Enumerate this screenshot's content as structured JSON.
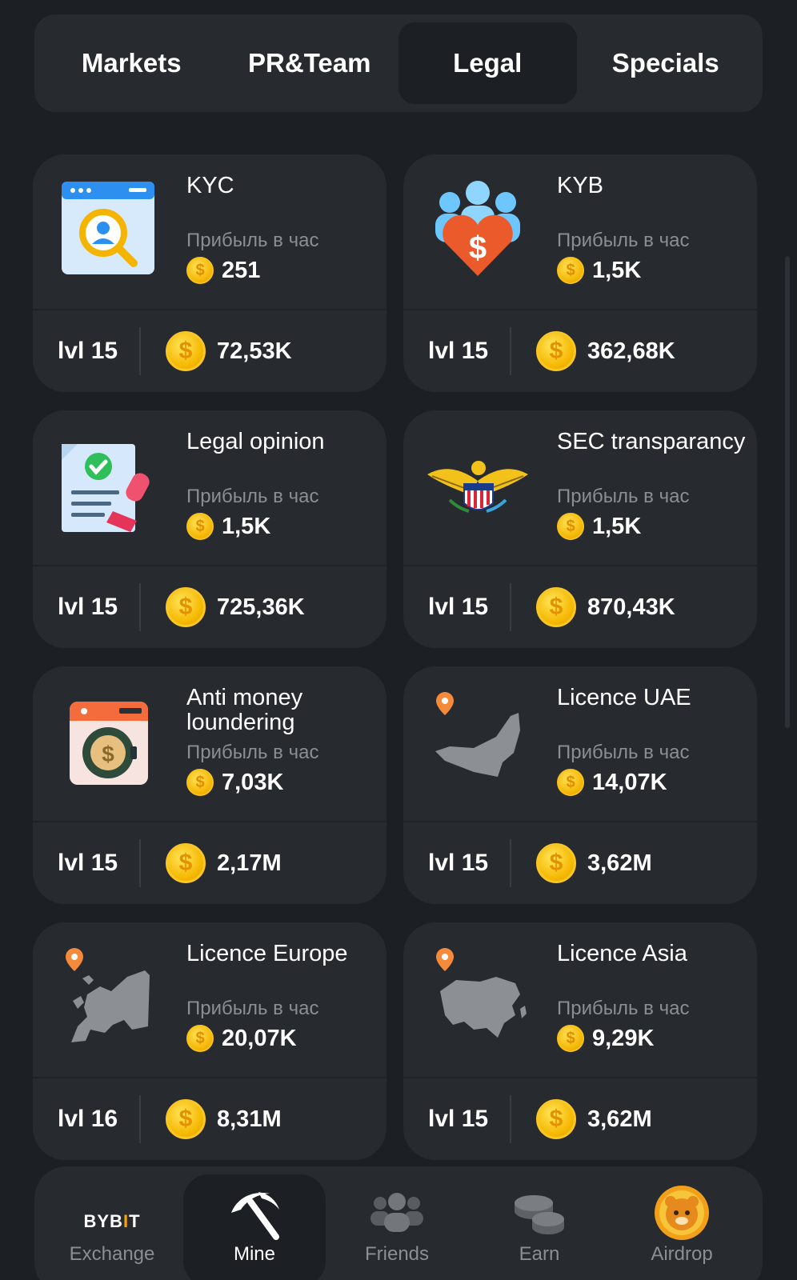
{
  "tabs": [
    {
      "label": "Markets",
      "active": false
    },
    {
      "label": "PR&Team",
      "active": false
    },
    {
      "label": "Legal",
      "active": true
    },
    {
      "label": "Specials",
      "active": false
    }
  ],
  "profit_label": "Прибыль в час",
  "cards": [
    {
      "title": "KYC",
      "profit": "251",
      "level": "lvl 15",
      "cost": "72,53K",
      "icon": "kyc-search-icon"
    },
    {
      "title": "KYB",
      "profit": "1,5K",
      "level": "lvl 15",
      "cost": "362,68K",
      "icon": "kyb-team-heart-icon"
    },
    {
      "title": "Legal opinion",
      "profit": "1,5K",
      "level": "lvl 15",
      "cost": "725,36K",
      "icon": "document-stamp-icon"
    },
    {
      "title": "SEC transparancy",
      "profit": "1,5K",
      "level": "lvl 15",
      "cost": "870,43K",
      "icon": "eagle-seal-icon"
    },
    {
      "title": "Anti money loundering",
      "profit": "7,03K",
      "level": "lvl 15",
      "cost": "2,17M",
      "icon": "washing-machine-icon"
    },
    {
      "title": "Licence UAE",
      "profit": "14,07K",
      "level": "lvl 15",
      "cost": "3,62M",
      "icon": "uae-map-icon"
    },
    {
      "title": "Licence Europe",
      "profit": "20,07K",
      "level": "lvl 16",
      "cost": "8,31M",
      "icon": "europe-map-icon"
    },
    {
      "title": "Licence Asia",
      "profit": "9,29K",
      "level": "lvl 15",
      "cost": "3,62M",
      "icon": "asia-map-icon"
    }
  ],
  "coin_symbol": "$",
  "nav": [
    {
      "label": "Exchange",
      "icon": "bybit-logo-icon",
      "logo_text_a": "BYB",
      "logo_text_b": "I",
      "logo_text_c": "T",
      "active": false
    },
    {
      "label": "Mine",
      "icon": "pickaxe-icon",
      "active": true
    },
    {
      "label": "Friends",
      "icon": "friends-icon",
      "active": false
    },
    {
      "label": "Earn",
      "icon": "coins-icon",
      "active": false
    },
    {
      "label": "Airdrop",
      "icon": "hamster-coin-icon",
      "active": false
    }
  ],
  "colors": {
    "background": "#1c1f24",
    "card": "#272a2f",
    "coin": "#f5b800",
    "muted": "#8b8e93"
  }
}
